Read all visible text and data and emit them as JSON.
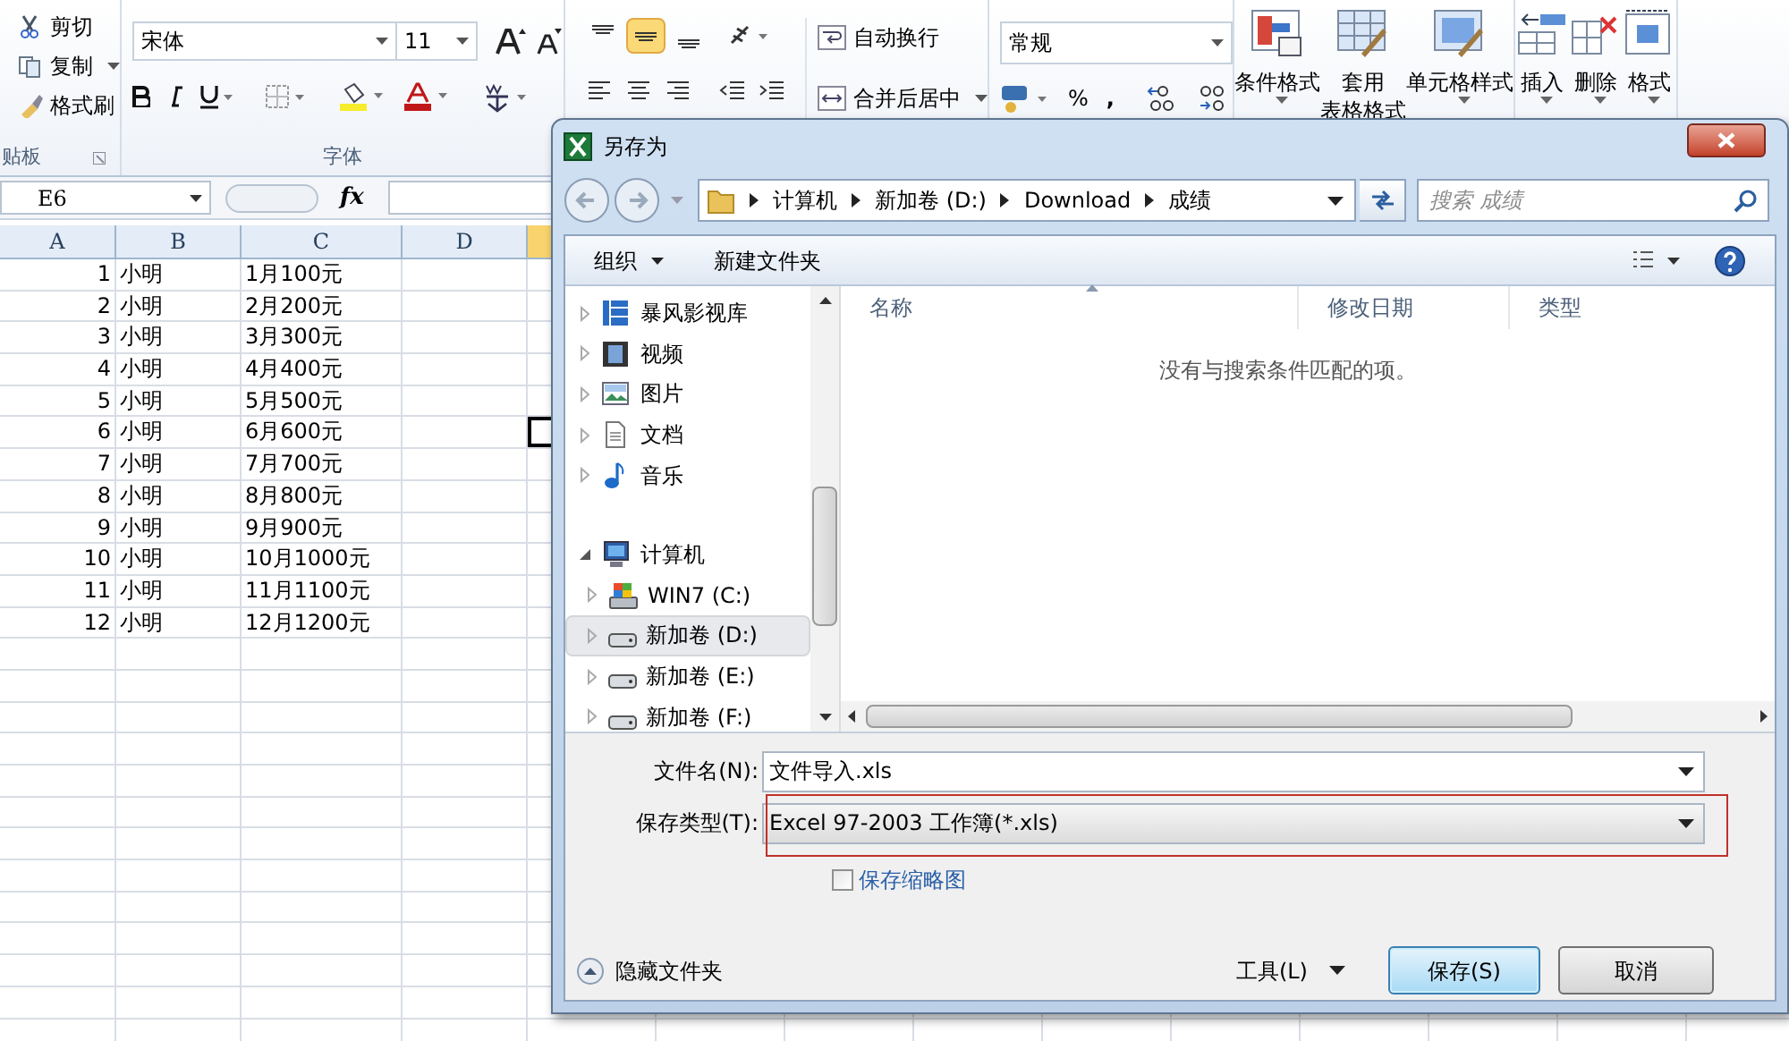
{
  "ribbon": {
    "clipboard": {
      "items": [
        "剪切",
        "复制",
        "格式刷"
      ],
      "label": "贴板"
    },
    "font": {
      "font_name": "宋体",
      "font_size": "11",
      "label": "字体"
    },
    "alignment": {
      "vertical": [
        {
          "kind": "top",
          "selected": false
        },
        {
          "kind": "middle",
          "selected": true
        },
        {
          "kind": "bottom",
          "selected": false
        }
      ],
      "wrap_text": "自动换行",
      "merge_center": "合并后居中"
    },
    "number": {
      "format": "常规",
      "percent": "%",
      "comma": ","
    },
    "styles": [
      {
        "lines": [
          "条件格式"
        ],
        "kind": "conditional"
      },
      {
        "lines": [
          "套用",
          "表格格式"
        ],
        "kind": "table"
      },
      {
        "lines": [
          "单元格样式"
        ],
        "kind": "cellstyle"
      }
    ],
    "cells": [
      {
        "lines": [
          "插入"
        ],
        "kind": "insert"
      },
      {
        "lines": [
          "删除"
        ],
        "kind": "delete"
      },
      {
        "lines": [
          "格式"
        ],
        "kind": "format"
      }
    ]
  },
  "formula_bar": {
    "name_box": "E6",
    "fx": "fx"
  },
  "sheet": {
    "columns": [
      "A",
      "B",
      "C",
      "D"
    ],
    "rows": [
      {
        "a": "1",
        "b": "小明",
        "c": "1月100元",
        "active": false
      },
      {
        "a": "2",
        "b": "小明",
        "c": "2月200元",
        "active": false
      },
      {
        "a": "3",
        "b": "小明",
        "c": "3月300元",
        "active": false
      },
      {
        "a": "4",
        "b": "小明",
        "c": "4月400元",
        "active": false
      },
      {
        "a": "5",
        "b": "小明",
        "c": "5月500元",
        "active": false
      },
      {
        "a": "6",
        "b": "小明",
        "c": "6月600元",
        "active": true
      },
      {
        "a": "7",
        "b": "小明",
        "c": "7月700元",
        "active": false
      },
      {
        "a": "8",
        "b": "小明",
        "c": "8月800元",
        "active": false
      },
      {
        "a": "9",
        "b": "小明",
        "c": "9月900元",
        "active": false
      },
      {
        "a": "10",
        "b": "小明",
        "c": "10月1000元",
        "active": false
      },
      {
        "a": "11",
        "b": "小明",
        "c": "11月1100元",
        "active": false
      },
      {
        "a": "12",
        "b": "小明",
        "c": "12月1200元",
        "active": false
      }
    ]
  },
  "dialog": {
    "title": "另存为",
    "breadcrumb": [
      "计算机",
      "新加卷 (D:)",
      "Download",
      "成绩"
    ],
    "search": {
      "placeholder": "搜索 成绩"
    },
    "toolbar": {
      "organize": "组织",
      "new_folder": "新建文件夹"
    },
    "nav": [
      {
        "label": "暴风影视库",
        "kind": "library",
        "selected": false
      },
      {
        "label": "视频",
        "kind": "video",
        "selected": false
      },
      {
        "label": "图片",
        "kind": "pictures",
        "selected": false
      },
      {
        "label": "文档",
        "kind": "documents",
        "selected": false
      },
      {
        "label": "音乐",
        "kind": "music",
        "selected": false
      },
      {
        "label": "计算机",
        "kind": "computer",
        "selected": false,
        "expanded": true,
        "children": [
          {
            "label": "WIN7 (C:)",
            "kind": "system_drive",
            "selected": false
          },
          {
            "label": "新加卷 (D:)",
            "kind": "drive",
            "selected": true
          },
          {
            "label": "新加卷 (E:)",
            "kind": "drive",
            "selected": false
          },
          {
            "label": "新加卷 (F:)",
            "kind": "drive",
            "selected": false
          }
        ]
      }
    ],
    "columns": [
      "名称",
      "修改日期",
      "类型"
    ],
    "empty_message": "没有与搜索条件匹配的项。",
    "file_name": {
      "label": "文件名(N):",
      "value": "文件导入.xls"
    },
    "save_type": {
      "label": "保存类型(T):",
      "value": "Excel 97-2003 工作簿(*.xls)"
    },
    "save_thumbnail": {
      "label": "保存缩略图",
      "checked": false
    },
    "hide_folders": "隐藏文件夹",
    "tools": "工具(L)",
    "save": "保存(S)",
    "cancel": "取消"
  }
}
